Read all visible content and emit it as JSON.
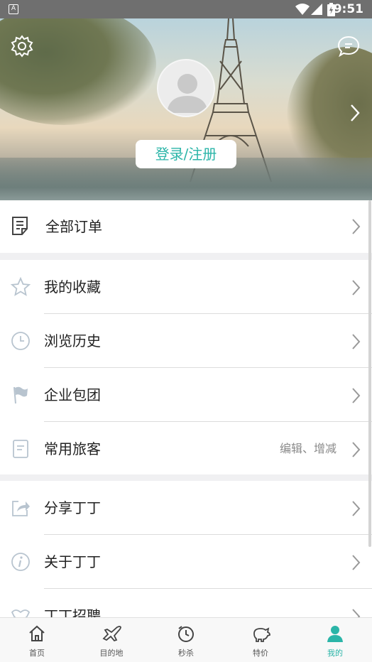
{
  "status_bar": {
    "time": "9:51",
    "app_icon": "A"
  },
  "header": {
    "login_label": "登录/注册",
    "icons": [
      "gear-icon",
      "chat-icon",
      "chevron-right-icon"
    ]
  },
  "menu": {
    "orders": {
      "label": "全部订单"
    },
    "group1": [
      {
        "label": "我的收藏",
        "icon": "star-icon"
      },
      {
        "label": "浏览历史",
        "icon": "clock-icon"
      },
      {
        "label": "企业包团",
        "icon": "flag-icon"
      },
      {
        "label": "常用旅客",
        "icon": "document-icon",
        "sub": "编辑、增减"
      }
    ],
    "group2": [
      {
        "label": "分享丁丁",
        "icon": "share-icon"
      },
      {
        "label": "关于丁丁",
        "icon": "info-icon"
      },
      {
        "label": "丁丁招聘",
        "icon": "handshake-icon"
      }
    ]
  },
  "bottom_nav": [
    {
      "label": "首页",
      "icon": "home-icon"
    },
    {
      "label": "目的地",
      "icon": "plane-icon"
    },
    {
      "label": "秒杀",
      "icon": "timer-icon"
    },
    {
      "label": "特价",
      "icon": "piggy-bank-icon"
    },
    {
      "label": "我的",
      "icon": "user-icon",
      "active": true
    }
  ],
  "colors": {
    "accent": "#2bb5a8",
    "icon_gray": "#b8c4cf",
    "text": "#222222"
  }
}
